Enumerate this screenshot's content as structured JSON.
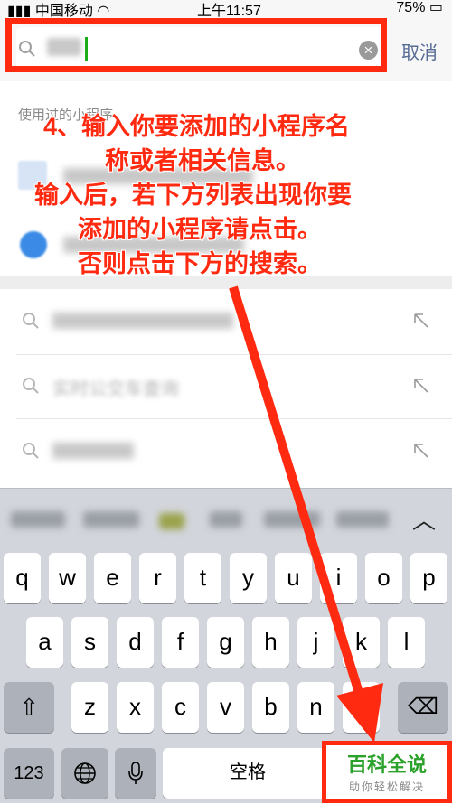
{
  "status_bar": {
    "carrier": "中国移动",
    "time": "上午11:57",
    "battery": "75%"
  },
  "search": {
    "cancel_label": "取消",
    "clear_icon": "close-circle-icon"
  },
  "used_section": {
    "title": "使用过的小程序"
  },
  "annotation": {
    "line1": "4、输入你要添加的小程序名",
    "line2": "称或者相关信息。",
    "line3": "输入后，若下方列表出现你要",
    "line4": "添加的小程序请点击。",
    "line5": "否则点击下方的搜索。",
    "color": "#ff2a10"
  },
  "suggestions": [
    {
      "text": "",
      "icon": "search-icon",
      "arrow": "arrow-up-left-icon"
    },
    {
      "text": "实时公交车查询",
      "icon": "search-icon",
      "arrow": "arrow-up-left-icon"
    },
    {
      "text": "",
      "icon": "search-icon",
      "arrow": "arrow-up-left-icon"
    }
  ],
  "keyboard": {
    "row1": [
      "q",
      "w",
      "e",
      "r",
      "t",
      "y",
      "u",
      "i",
      "o",
      "p"
    ],
    "row2": [
      "a",
      "s",
      "d",
      "f",
      "g",
      "h",
      "j",
      "k",
      "l"
    ],
    "row3": [
      "z",
      "x",
      "c",
      "v",
      "b",
      "n",
      "m"
    ],
    "num_label": "123",
    "space_label": "空格"
  },
  "logo": {
    "main": "百科全说",
    "sub": "助你轻松解决"
  },
  "colors": {
    "accent_green": "#1aad19",
    "cancel_blue": "#576b95"
  }
}
